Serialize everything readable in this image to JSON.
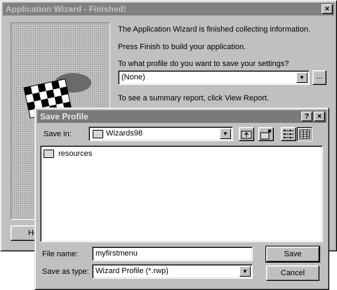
{
  "wizard": {
    "title": "Application Wizard - Finished!",
    "close_glyph": "×",
    "line1": "The Application Wizard is finished collecting information.",
    "line2": "Press Finish to build your application.",
    "profile_label": "To what profile do you want to save your settings?",
    "profile_value": "(None)",
    "browse_label": "...",
    "summary_text": "To see a summary report, click View Report.",
    "help_button": "He"
  },
  "dialog": {
    "title": "Save Profile",
    "help_glyph": "?",
    "close_glyph": "×",
    "save_in_label": "Save in:",
    "save_in_value": "Wizards98",
    "files": [
      "resources"
    ],
    "file_name_label": "File name:",
    "file_name_value": "myfirstmenu",
    "save_type_label": "Save as type:",
    "save_type_value": "Wizard Profile (*.rwp)",
    "save_button": "Save",
    "cancel_button": "Cancel"
  },
  "icons": {
    "up_folder": "up-folder-icon",
    "new_folder": "new-folder-icon",
    "list_view": "list-view-icon",
    "details_view": "details-view-icon",
    "checkered_flag": "checkered-flag-icon",
    "folder": "folder-icon"
  }
}
